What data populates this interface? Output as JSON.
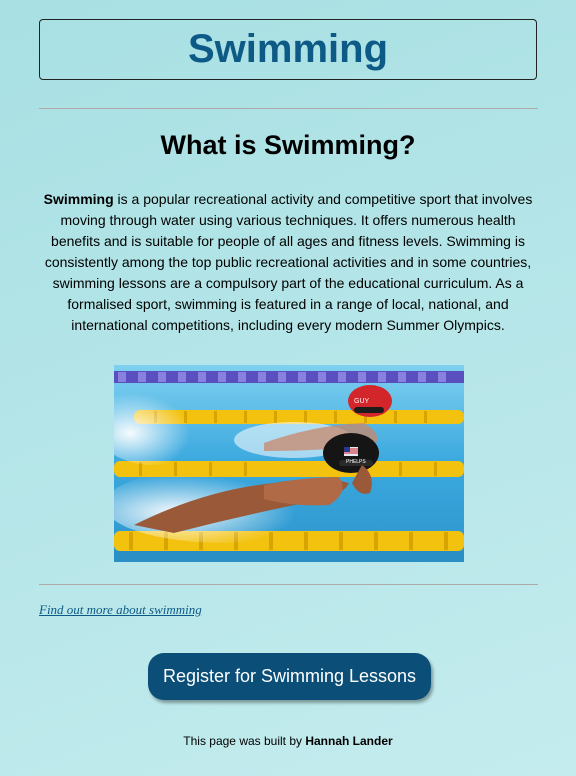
{
  "header": {
    "title": "Swimming"
  },
  "main": {
    "heading": "What is Swimming?",
    "intro_bold": "Swimming",
    "intro_text": " is a popular recreational activity and competitive sport that involves moving through water using various techniques. It offers numerous health benefits and is suitable for people of all ages and fitness levels. Swimming is consistently among the top public recreational activities and in some countries, swimming lessons are a compulsory part of the educational curriculum. As a formalised sport, swimming is featured in a range of local, national, and international competitions, including every modern Summer Olympics.",
    "photo": {
      "cap_text_back": "GUY",
      "cap_text_front": "PHELPS"
    },
    "link_text": "Find out more about swimming",
    "register_label": "Register for Swimming Lessons"
  },
  "footer": {
    "prefix": "This page was built by ",
    "author": "Hannah Lander"
  },
  "colors": {
    "accent": "#0e5a86",
    "button": "#0b4f78",
    "pool": "#49b3e0",
    "lane_rope": "#f2c20f"
  }
}
